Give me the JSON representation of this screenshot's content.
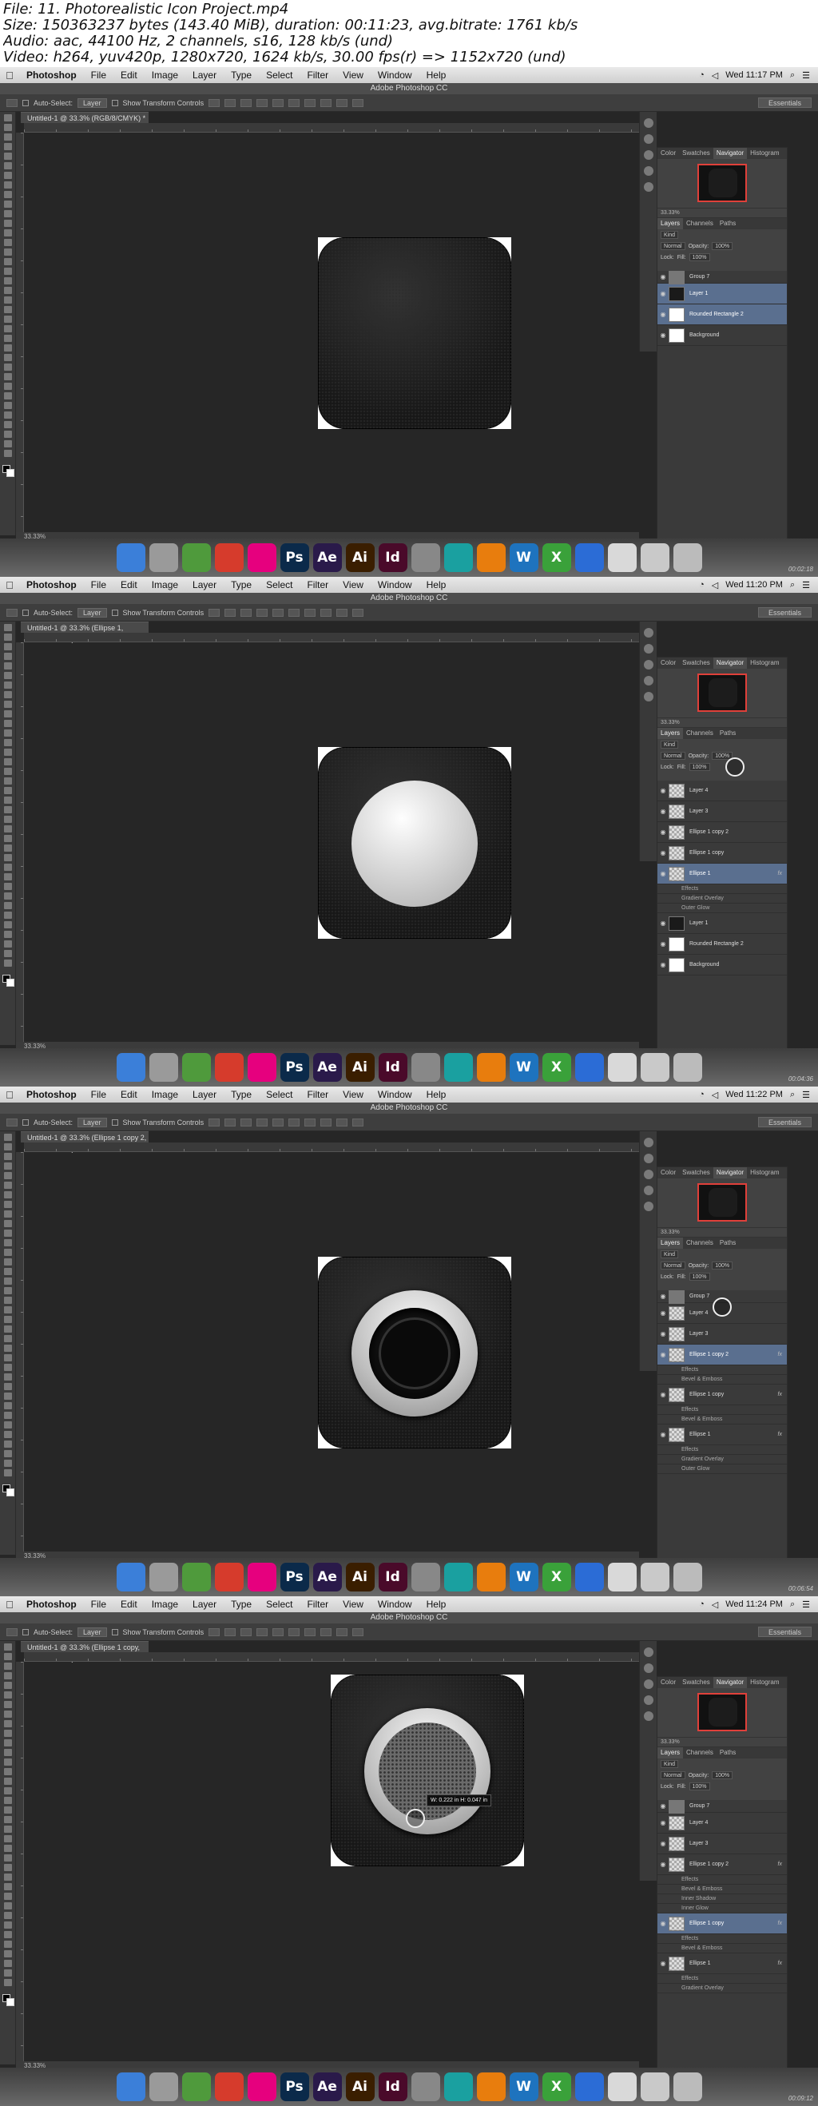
{
  "header": {
    "line1": "File: 11. Photorealistic Icon Project.mp4",
    "line2": "Size: 150363237 bytes (143.40 MiB), duration: 00:11:23, avg.bitrate: 1761 kb/s",
    "line3": "Audio: aac, 44100 Hz, 2 channels, s16, 128 kb/s (und)",
    "line4": "Video: h264, yuv420p, 1280x720, 1624 kb/s, 30.00 fps(r) => 1152x720 (und)"
  },
  "menu": {
    "app": "Photoshop",
    "items": [
      "File",
      "Edit",
      "Image",
      "Layer",
      "Type",
      "Select",
      "Filter",
      "View",
      "Window",
      "Help"
    ]
  },
  "options": {
    "auto_select": "Auto-Select:",
    "layer": "Layer",
    "transform": "Show Transform Controls",
    "workspace": "Essentials"
  },
  "panel_tabs": {
    "color": "Color",
    "swatches": "Swatches",
    "navigator": "Navigator",
    "histogram": "Histogram"
  },
  "layer_tabs": {
    "layers": "Layers",
    "channels": "Channels",
    "paths": "Paths"
  },
  "layer_opts": {
    "kind": "Kind",
    "blend": "Normal",
    "opacity_label": "Opacity:",
    "opacity": "100%",
    "lock": "Lock:",
    "fill_label": "Fill:",
    "fill": "100%"
  },
  "window_title": "Adobe Photoshop CC",
  "shots": [
    {
      "clock": "Wed 11:17 PM",
      "doc_tab": "Untitled-1 @ 33.3% (RGB/8/CMYK) *",
      "zoom": "33.33%",
      "status": "33.33%",
      "time": "00:02:18",
      "layers": [
        {
          "name": "Group 7",
          "kind": "group"
        },
        {
          "name": "Layer 1",
          "kind": "dark",
          "sel": true
        },
        {
          "name": "Rounded Rectangle 2",
          "kind": "white",
          "sel": true
        },
        {
          "name": "Background",
          "kind": "white"
        }
      ]
    },
    {
      "clock": "Wed 11:20 PM",
      "doc_tab": "Untitled-1 @ 33.3% (Ellipse 1, RGB/8/CMYK) *",
      "zoom": "33.33%",
      "status": "33.33%",
      "time": "00:04:36",
      "layers": [
        {
          "name": "Layer 4",
          "kind": "check"
        },
        {
          "name": "Layer 3",
          "kind": "check"
        },
        {
          "name": "Ellipse 1 copy 2",
          "kind": "check"
        },
        {
          "name": "Ellipse 1 copy",
          "kind": "check"
        },
        {
          "name": "Ellipse 1",
          "kind": "check",
          "sel": true,
          "fx": true
        },
        {
          "name": "Effects",
          "kind": "sub"
        },
        {
          "name": "Gradient Overlay",
          "kind": "sub"
        },
        {
          "name": "Outer Glow",
          "kind": "sub"
        },
        {
          "name": "Layer 1",
          "kind": "dark"
        },
        {
          "name": "Rounded Rectangle 2",
          "kind": "white"
        },
        {
          "name": "Background",
          "kind": "white"
        }
      ]
    },
    {
      "clock": "Wed 11:22 PM",
      "doc_tab": "Untitled-1 @ 33.3% (Ellipse 1 copy 2, RGB/8/CMYK) *",
      "zoom": "33.33%",
      "status": "33.33%",
      "time": "00:06:54",
      "layers": [
        {
          "name": "Group 7",
          "kind": "group"
        },
        {
          "name": "Layer 4",
          "kind": "check"
        },
        {
          "name": "Layer 3",
          "kind": "check"
        },
        {
          "name": "Ellipse 1 copy 2",
          "kind": "check",
          "sel": true,
          "fx": true
        },
        {
          "name": "Effects",
          "kind": "sub"
        },
        {
          "name": "Bevel & Emboss",
          "kind": "sub"
        },
        {
          "name": "Ellipse 1 copy",
          "kind": "check",
          "fx": true
        },
        {
          "name": "Effects",
          "kind": "sub"
        },
        {
          "name": "Bevel & Emboss",
          "kind": "sub"
        },
        {
          "name": "Ellipse 1",
          "kind": "check",
          "fx": true
        },
        {
          "name": "Effects",
          "kind": "sub"
        },
        {
          "name": "Gradient Overlay",
          "kind": "sub"
        },
        {
          "name": "Outer Glow",
          "kind": "sub"
        }
      ]
    },
    {
      "clock": "Wed 11:24 PM",
      "doc_tab": "Untitled-1 @ 33.3% (Ellipse 1 copy, RGB/8/CMYK) *",
      "zoom": "33.33%",
      "status": "33.33%",
      "time": "00:09:12",
      "measure": "W: 0.222 in  H: 0.047 in",
      "layers": [
        {
          "name": "Group 7",
          "kind": "group"
        },
        {
          "name": "Layer 4",
          "kind": "check"
        },
        {
          "name": "Layer 3",
          "kind": "check"
        },
        {
          "name": "Ellipse 1 copy 2",
          "kind": "check",
          "fx": true
        },
        {
          "name": "Effects",
          "kind": "sub"
        },
        {
          "name": "Bevel & Emboss",
          "kind": "sub"
        },
        {
          "name": "Inner Shadow",
          "kind": "sub"
        },
        {
          "name": "Inner Glow",
          "kind": "sub"
        },
        {
          "name": "Ellipse 1 copy",
          "kind": "check",
          "sel": true,
          "fx": true
        },
        {
          "name": "Effects",
          "kind": "sub"
        },
        {
          "name": "Bevel & Emboss",
          "kind": "sub"
        },
        {
          "name": "Ellipse 1",
          "kind": "check",
          "fx": true
        },
        {
          "name": "Effects",
          "kind": "sub"
        },
        {
          "name": "Gradient Overlay",
          "kind": "sub"
        }
      ]
    }
  ],
  "dock": [
    {
      "label": "",
      "color": "#3b7fd9",
      "icon": "finder-icon"
    },
    {
      "label": "",
      "color": "#9a9a9a",
      "icon": "launchpad-icon"
    },
    {
      "label": "",
      "color": "#4f9a3c",
      "icon": "photo-booth-icon"
    },
    {
      "label": "",
      "color": "#d63b2c",
      "icon": "chrome-icon"
    },
    {
      "label": "",
      "color": "#e6007e",
      "icon": "cc-icon"
    },
    {
      "label": "Ps",
      "color": "#0b2a4a",
      "icon": "photoshop-icon"
    },
    {
      "label": "Ae",
      "color": "#2a1a4a",
      "icon": "after-effects-icon"
    },
    {
      "label": "Ai",
      "color": "#3a1e00",
      "icon": "illustrator-icon"
    },
    {
      "label": "Id",
      "color": "#4a0a2a",
      "icon": "indesign-icon"
    },
    {
      "label": "",
      "color": "#888",
      "icon": "utility-icon"
    },
    {
      "label": "",
      "color": "#1aa0a0",
      "icon": "maya-icon"
    },
    {
      "label": "",
      "color": "#e87d0d",
      "icon": "blender-icon"
    },
    {
      "label": "W",
      "color": "#1e73be",
      "icon": "wordpress-icon"
    },
    {
      "label": "X",
      "color": "#3aa13a",
      "icon": "excel-icon"
    },
    {
      "label": "",
      "color": "#2b6cd6",
      "icon": "quicktime-icon"
    },
    {
      "label": "",
      "color": "#d9d9d9",
      "icon": "document-icon"
    },
    {
      "label": "",
      "color": "#c9c9c9",
      "icon": "preview-icon"
    },
    {
      "label": "",
      "color": "#bbb",
      "icon": "trash-icon"
    }
  ]
}
